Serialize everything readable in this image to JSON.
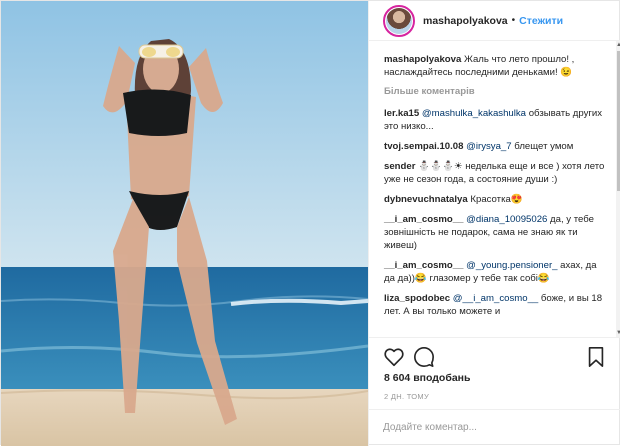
{
  "header": {
    "username": "mashapolyakova",
    "dot": "•",
    "follow_label": "Стежити"
  },
  "caption": {
    "username": "mashapolyakova",
    "text": "Жаль что лето прошло! , наслаждайтесь последними деньками! 😉"
  },
  "more_comments_label": "Більше коментарів",
  "comments": [
    {
      "user": "ler.ka15",
      "mention": "@mashulka_kakashulka",
      "text": " обзывать других это низко..."
    },
    {
      "user": "tvoj.sempai.10.08",
      "mention": "@irysya_7",
      "text": " блещет умом"
    },
    {
      "user": "sender",
      "mention": "",
      "text": "⛄⛄⛄☀ неделька еще и все ) хотя лето уже не сезон года, а состояние души :)"
    },
    {
      "user": "dybnevuchnatalya",
      "mention": "",
      "text": "Красотка😍"
    },
    {
      "user": "__i_am_cosmo__",
      "mention": "@diana_10095026",
      "text": " да, у тебе зовнішність не подарок, сама не знаю як ти живеш)"
    },
    {
      "user": "__i_am_cosmo__",
      "mention": "@_young.pensioner_",
      "text": " ахах, да да да))😂 глазомер у тебе так собі😂"
    },
    {
      "user": "liza_spodobec",
      "mention": "@__i_am_cosmo__",
      "text": " боже, и вы 18 лет. А вы только можете и"
    }
  ],
  "likes": "8 604 вподобань",
  "time": "2 ДН. ТОМУ",
  "comment_input": {
    "placeholder": "Додайте коментар..."
  },
  "icons": {
    "like": "heart-icon",
    "comment": "comment-bubble-icon",
    "save": "bookmark-icon",
    "scroll_up": "▲",
    "scroll_down": "▼"
  }
}
